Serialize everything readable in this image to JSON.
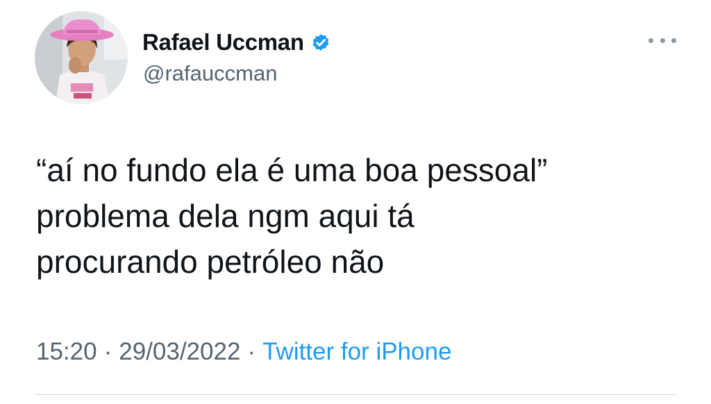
{
  "author": {
    "display_name": "Rafael Uccman",
    "handle": "@rafauccman",
    "verified": true,
    "avatar_icon": "profile-photo-pink-cowboy-hat"
  },
  "tweet": {
    "text": "“aí no fundo ela é uma boa pessoal”\nproblema dela ngm aqui tá\nprocurando petróleo não",
    "time": "15:20",
    "separator": "·",
    "date": "29/03/2022",
    "source": "Twitter for iPhone"
  },
  "colors": {
    "text": "#0f1419",
    "secondary": "#536471",
    "link": "#1d9bf0",
    "verified_badge": "#1d9bf0"
  }
}
